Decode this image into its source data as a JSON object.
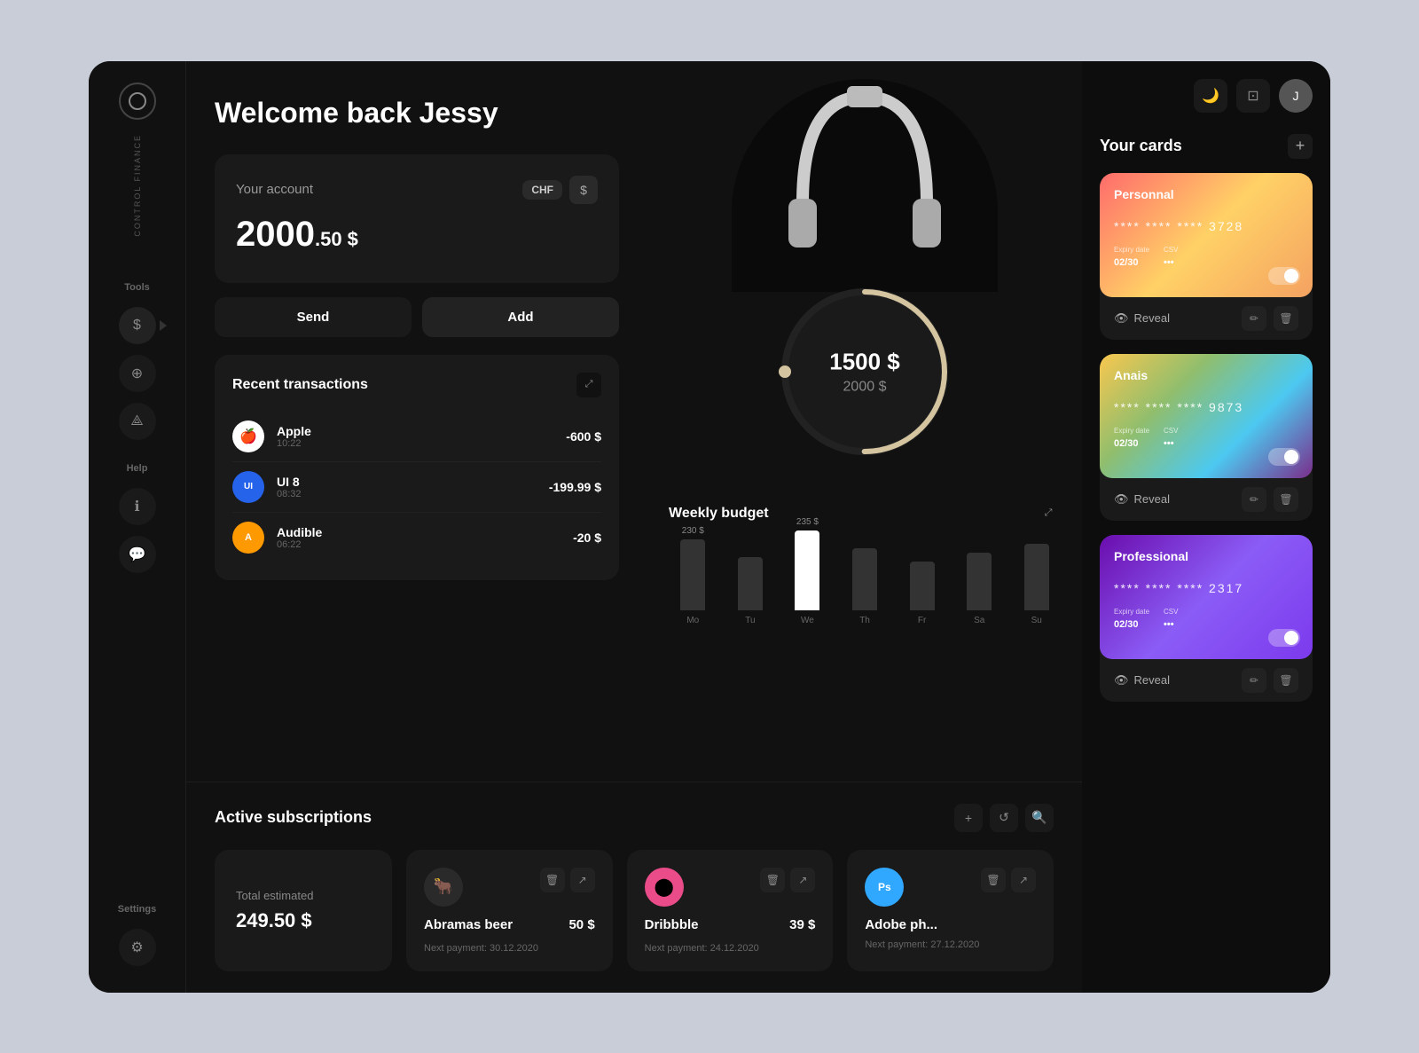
{
  "app": {
    "title": "Control Finance"
  },
  "sidebar": {
    "brand": "CONTROL FINANCE",
    "tools_label": "Tools",
    "help_label": "Help",
    "settings_label": "Settings",
    "nav_items": [
      {
        "id": "dollar",
        "icon": "$",
        "active": true
      },
      {
        "id": "globe",
        "icon": "🌐",
        "active": false
      },
      {
        "id": "tree",
        "icon": "⟁",
        "active": false
      },
      {
        "id": "info",
        "icon": "ℹ",
        "active": false
      },
      {
        "id": "chat",
        "icon": "💬",
        "active": false
      },
      {
        "id": "settings",
        "icon": "⚙",
        "active": false
      }
    ]
  },
  "header": {
    "welcome": "Welcome back Jessy"
  },
  "account": {
    "label": "Your account",
    "currency_tag": "CHF",
    "currency_icon": "$",
    "balance_main": "2000",
    "balance_decimal": ".50 $"
  },
  "buttons": {
    "send": "Send",
    "add": "Add"
  },
  "transactions": {
    "title": "Recent transactions",
    "items": [
      {
        "name": "Apple",
        "time": "10:22",
        "amount": "-600 $",
        "icon": "🍎",
        "bg": "#fff"
      },
      {
        "name": "UI 8",
        "time": "08:32",
        "amount": "-199.99 $",
        "icon": "UI",
        "bg": "#2563eb"
      },
      {
        "name": "Audible",
        "time": "06:22",
        "amount": "-20 $",
        "icon": "A",
        "bg": "#ff9900"
      }
    ]
  },
  "budget": {
    "title": "Weekly budget",
    "current": "1500 $",
    "total": "2000 $",
    "circle_progress": 75,
    "bars": [
      {
        "label": "Mo",
        "value": 80,
        "amount": "230 $",
        "highlight": false
      },
      {
        "label": "Tu",
        "value": 60,
        "amount": "",
        "highlight": false
      },
      {
        "label": "We",
        "value": 95,
        "amount": "235 $",
        "highlight": true
      },
      {
        "label": "Th",
        "value": 70,
        "amount": "",
        "highlight": false
      },
      {
        "label": "Fr",
        "value": 55,
        "amount": "",
        "highlight": false
      },
      {
        "label": "Sa",
        "value": 65,
        "amount": "",
        "highlight": false
      },
      {
        "label": "Su",
        "value": 75,
        "amount": "",
        "highlight": false
      }
    ]
  },
  "subscriptions": {
    "title": "Active subscriptions",
    "total_label": "Total estimated",
    "total_amount": "249.50 $",
    "items": [
      {
        "name": "Abramas beer",
        "price": "50 $",
        "next_label": "Next payment:",
        "next_date": "30.12.2020",
        "icon": "🐂"
      },
      {
        "name": "Dribbble",
        "price": "39 $",
        "next_label": "Next payment:",
        "next_date": "24.12.2020",
        "icon": "🏀",
        "icon_color": "#ea4c89"
      },
      {
        "name": "Adobe ph...",
        "price": "",
        "next_label": "Next payment:",
        "next_date": "27.12.2020",
        "icon": "Ps",
        "icon_color": "#31a8ff"
      }
    ]
  },
  "cards_panel": {
    "title": "Your cards",
    "add_btn": "+",
    "cards": [
      {
        "id": "personal",
        "name": "Personnal",
        "number": "**** **** **** 3728",
        "expiry_label": "Expiry date",
        "expiry_value": "02/30",
        "csv_label": "CSV",
        "csv_value": "•••",
        "reveal_label": "Reveal",
        "enabled": true,
        "gradient": "personal"
      },
      {
        "id": "anais",
        "name": "Anais",
        "number": "**** **** **** 9873",
        "expiry_label": "Expiry date",
        "expiry_value": "02/30",
        "csv_label": "CSV",
        "csv_value": "•••",
        "reveal_label": "Reveal",
        "enabled": true,
        "gradient": "anais"
      },
      {
        "id": "professional",
        "name": "Professional",
        "number": "**** **** **** 2317",
        "expiry_label": "Expiry date",
        "expiry_value": "02/30",
        "csv_label": "CSV",
        "csv_value": "•••",
        "reveal_label": "Reveal",
        "enabled": true,
        "gradient": "professional"
      }
    ]
  },
  "top_bar": {
    "moon_icon": "🌙",
    "window_icon": "⊡",
    "avatar_text": "J"
  }
}
